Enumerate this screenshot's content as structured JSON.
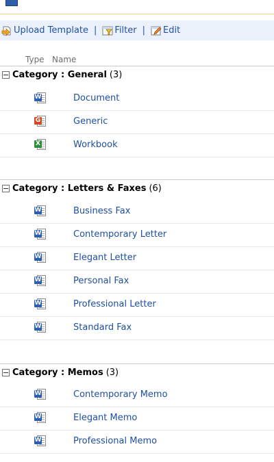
{
  "toolbar": {
    "upload_label": "Upload Template",
    "separator": "|",
    "filter_label": "Filter",
    "edit_label": "Edit"
  },
  "columns": {
    "type": "Type",
    "name": "Name"
  },
  "groups": [
    {
      "title": "Category : General",
      "count": "(3)",
      "items": [
        {
          "name": "Document",
          "icon": "word-document-icon"
        },
        {
          "name": "Generic",
          "icon": "generic-document-icon"
        },
        {
          "name": "Workbook",
          "icon": "excel-workbook-icon"
        }
      ]
    },
    {
      "title": "Category : Letters & Faxes",
      "count": "(6)",
      "items": [
        {
          "name": "Business Fax",
          "icon": "word-document-icon"
        },
        {
          "name": "Contemporary Letter",
          "icon": "word-document-icon"
        },
        {
          "name": "Elegant Letter",
          "icon": "word-document-icon"
        },
        {
          "name": "Personal Fax",
          "icon": "word-document-icon"
        },
        {
          "name": "Professional Letter",
          "icon": "word-document-icon"
        },
        {
          "name": "Standard Fax",
          "icon": "word-document-icon"
        }
      ]
    },
    {
      "title": "Category : Memos",
      "count": "(3)",
      "items": [
        {
          "name": "Contemporary Memo",
          "icon": "word-document-icon"
        },
        {
          "name": "Elegant Memo",
          "icon": "word-document-icon"
        },
        {
          "name": "Professional Memo",
          "icon": "word-document-icon"
        }
      ]
    }
  ],
  "colors": {
    "link": "#1f4fa0",
    "toolbar_bg": "#eaf1fb",
    "word": "#2b5fb3",
    "generic": "#d24a2a",
    "excel": "#2f8f3a"
  }
}
